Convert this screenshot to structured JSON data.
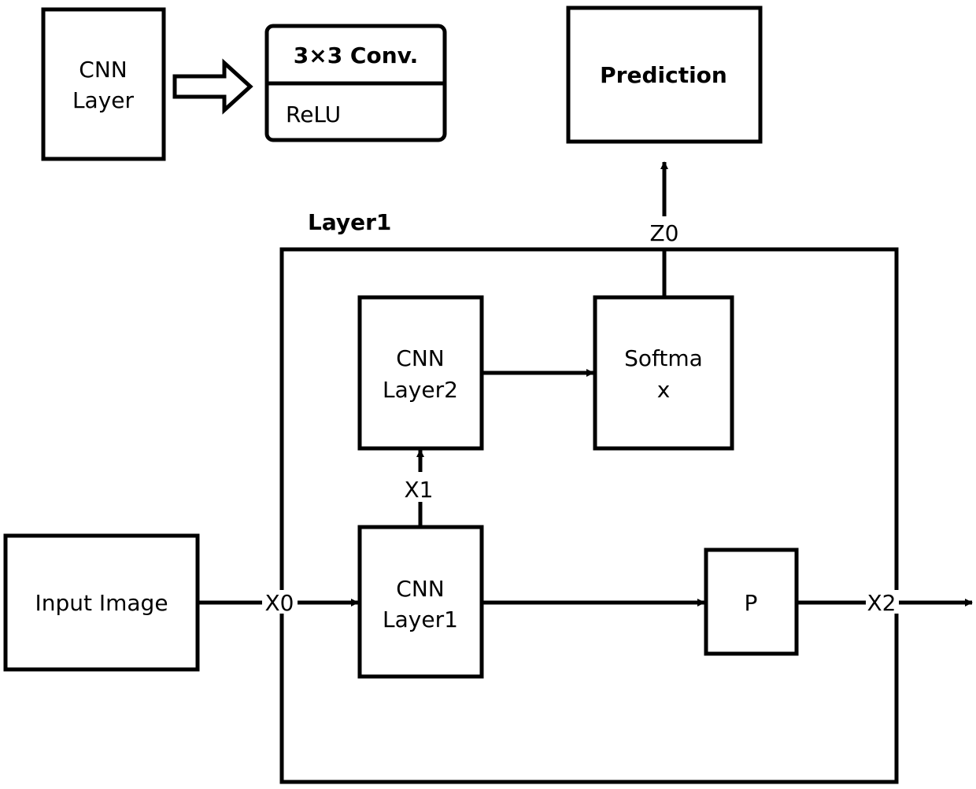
{
  "legend": {
    "cnn_layer_box": {
      "line1": "CNN",
      "line2": "Layer"
    },
    "expansion": {
      "top": "3×3 Conv.",
      "bottom": "ReLU"
    }
  },
  "prediction": {
    "label": "Prediction"
  },
  "container": {
    "title": "Layer1"
  },
  "nodes": {
    "cnn_layer2": {
      "line1": "CNN",
      "line2": "Layer2"
    },
    "softmax": {
      "line1": "Softma",
      "line2": "x"
    },
    "cnn_layer1": {
      "line1": "CNN",
      "line2": "Layer1"
    },
    "pool": {
      "label": "P"
    },
    "input_image": {
      "label": "Input Image"
    }
  },
  "edges": {
    "x0": "X0",
    "x1": "X1",
    "x2": "X2",
    "z0": "Z0"
  }
}
